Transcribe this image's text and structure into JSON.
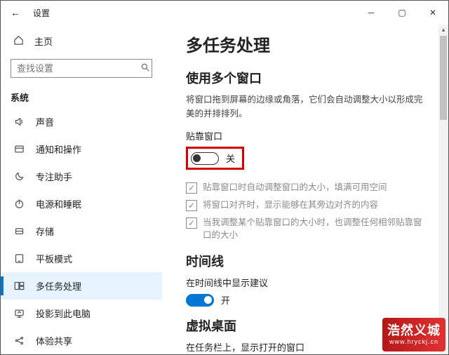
{
  "titlebar": {
    "back": "←",
    "title": "设置"
  },
  "home": {
    "label": "主页"
  },
  "search": {
    "placeholder": "查找设置"
  },
  "nav": {
    "header": "系统",
    "items": [
      {
        "label": "声音",
        "icon": "volume"
      },
      {
        "label": "通知和操作",
        "icon": "notify"
      },
      {
        "label": "专注助手",
        "icon": "moon"
      },
      {
        "label": "电源和睡眠",
        "icon": "power"
      },
      {
        "label": "存储",
        "icon": "storage"
      },
      {
        "label": "平板模式",
        "icon": "tablet"
      },
      {
        "label": "多任务处理",
        "icon": "multitask"
      },
      {
        "label": "投影到此电脑",
        "icon": "project"
      },
      {
        "label": "体验共享",
        "icon": "share"
      }
    ],
    "activeIndex": 6
  },
  "main": {
    "pageTitle": "多任务处理",
    "snap": {
      "sectionTitle": "使用多个窗口",
      "desc": "将窗口拖到屏幕的边缘或角落，它们会自动调整大小以形成完美的并排排列。",
      "toggleLabel": "贴靠窗口",
      "toggleState": "关",
      "checkboxes": [
        "贴靠窗口时自动调整窗口的大小，填满可用空间",
        "将窗口对齐时，显示能够在其旁边对齐的内容",
        "当我调整某个贴靠窗口的大小时，也调整任何相邻贴靠窗口的大小"
      ]
    },
    "timeline": {
      "sectionTitle": "时间线",
      "label": "在时间线中显示建议",
      "toggleState": "开"
    },
    "virtualDesktop": {
      "sectionTitle": "虚拟桌面",
      "label": "在任务栏上，显示打开的窗口"
    }
  },
  "watermark": {
    "line1": "浩然义城",
    "line2": "www.hryckj.cn"
  }
}
